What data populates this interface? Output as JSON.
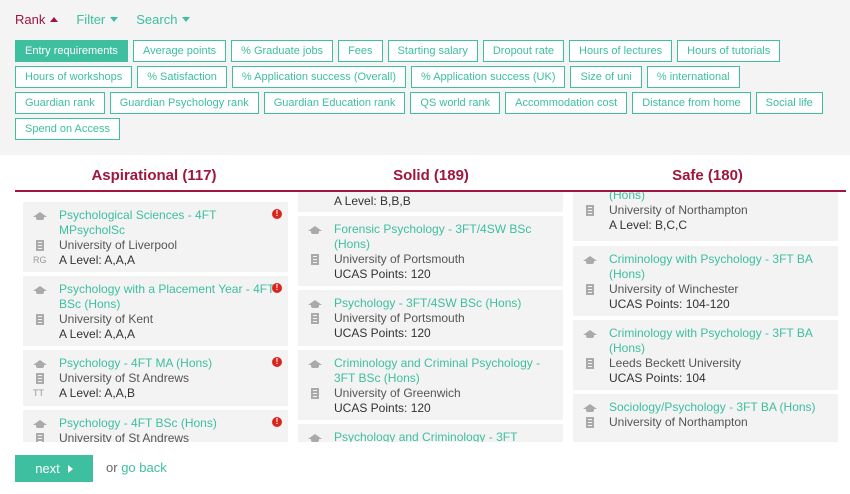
{
  "menu": {
    "rank": "Rank",
    "filter": "Filter",
    "search": "Search"
  },
  "chips": [
    [
      "Entry requirements",
      "Average points",
      "% Graduate jobs",
      "Fees",
      "Starting salary",
      "Dropout rate",
      "Hours of lectures",
      "Hours of tutorials"
    ],
    [
      "Hours of workshops",
      "% Satisfaction",
      "% Application success (Overall)",
      "% Application success (UK)",
      "Size of uni",
      "% international"
    ],
    [
      "Guardian rank",
      "Guardian Psychology rank",
      "Guardian Education rank",
      "QS world rank",
      "Accommodation cost",
      "Distance from home",
      "Social life"
    ],
    [
      "Spend on Access"
    ]
  ],
  "columns": {
    "aspirational": {
      "heading": "Aspirational (117)"
    },
    "solid": {
      "heading": "Solid (189)"
    },
    "safe": {
      "heading": "Safe (180)"
    }
  },
  "aspirational_cards": [
    {
      "title": "Psychological Sciences - 4FT MPsycholSc",
      "uni": "University of Liverpool",
      "badge": "RG",
      "req": "A Level: A,A,A",
      "warn": "!"
    },
    {
      "title": "Psychology with a Placement Year - 4FT BSc (Hons)",
      "uni": "University of Kent",
      "badge": "",
      "req": "A Level: A,A,A",
      "warn": "!"
    },
    {
      "title": "Psychology - 4FT MA (Hons)",
      "uni": "University of St Andrews",
      "badge": "TT",
      "req": "A Level: A,A,B",
      "warn": "!"
    },
    {
      "title": "Psychology - 4FT BSc (Hons)",
      "uni": "University of St Andrews",
      "badge": "",
      "req": "",
      "warn": "!"
    }
  ],
  "solid_cards": [
    {
      "title": "",
      "uni": "",
      "req": "A Level: B,B,B"
    },
    {
      "title": "Forensic Psychology - 3FT/4SW BSc (Hons)",
      "uni": "University of Portsmouth",
      "req": "UCAS Points: 120"
    },
    {
      "title": "Psychology - 3FT/4SW BSc (Hons)",
      "uni": "University of Portsmouth",
      "req": "UCAS Points: 120"
    },
    {
      "title": "Criminology and Criminal Psychology - 3FT BSc (Hons)",
      "uni": "University of Greenwich",
      "req": "UCAS Points: 120"
    },
    {
      "title": "Psychology and Criminology - 3FT",
      "uni": "",
      "req": ""
    }
  ],
  "safe_cards": [
    {
      "title": "(Hons)",
      "uni": "University of Northampton",
      "req": "A Level: B,C,C"
    },
    {
      "title": "Criminology with Psychology - 3FT BA (Hons)",
      "uni": "University of Winchester",
      "req": "UCAS Points: 104-120"
    },
    {
      "title": "Criminology with Psychology - 3FT BA (Hons)",
      "uni": "Leeds Beckett University",
      "req": "UCAS Points: 104"
    },
    {
      "title": "Sociology/Psychology - 3FT BA (Hons)",
      "uni": "University of Northampton",
      "req": ""
    }
  ],
  "footer": {
    "next": "next",
    "or": "or",
    "go_back": "go back"
  }
}
